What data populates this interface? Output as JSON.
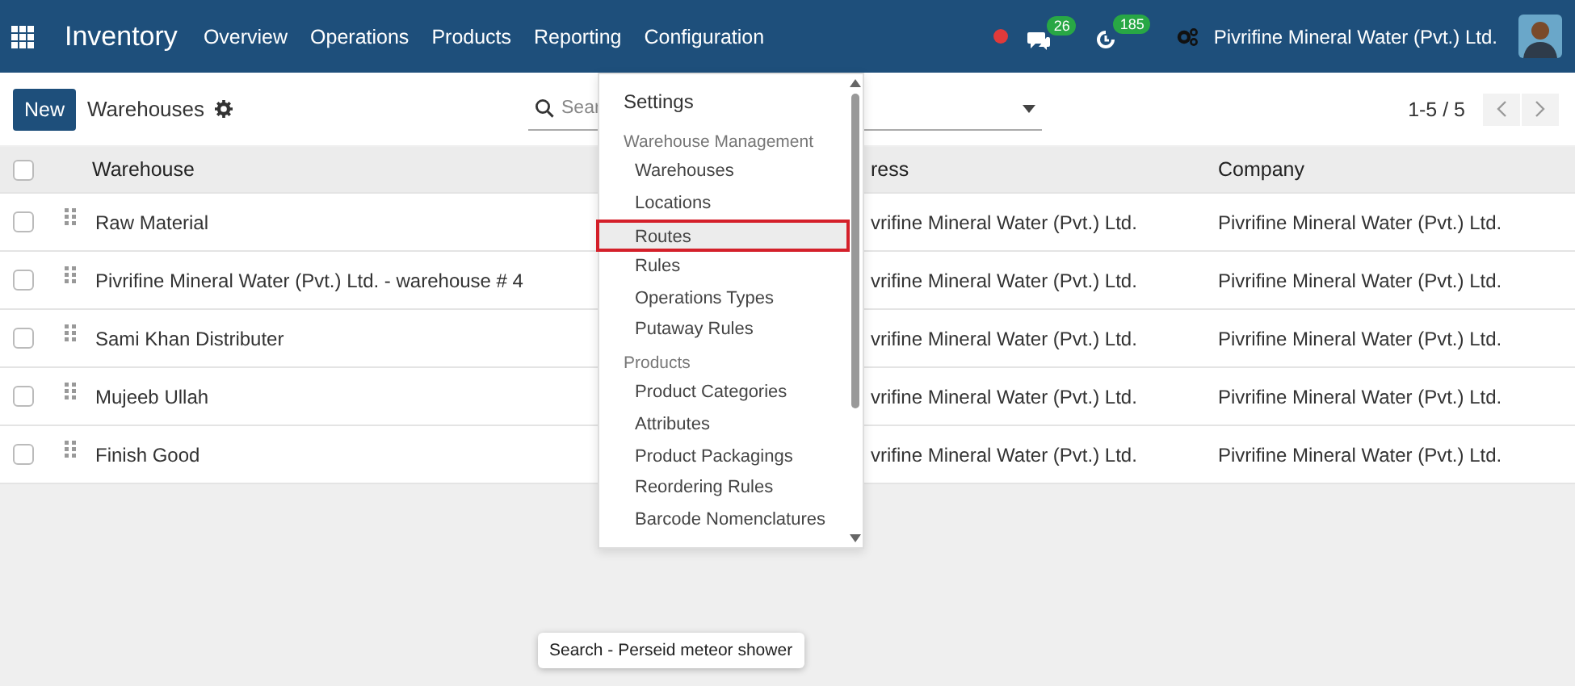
{
  "navbar": {
    "app_name": "Inventory",
    "menu": [
      {
        "label": "Overview"
      },
      {
        "label": "Operations"
      },
      {
        "label": "Products"
      },
      {
        "label": "Reporting"
      },
      {
        "label": "Configuration"
      }
    ],
    "messages_badge": "26",
    "activities_badge": "185",
    "company": "Pivrifine Mineral Water (Pvt.) Ltd."
  },
  "control_panel": {
    "new_button": "New",
    "breadcrumb": "Warehouses",
    "search": {
      "value": "Sear"
    },
    "pager": "1-5 / 5"
  },
  "table": {
    "select_all": {
      "checked": false
    },
    "columns": [
      "Warehouse",
      "ress",
      "Company"
    ],
    "rows": [
      {
        "checked": false,
        "warehouse": "Raw Material",
        "address": "vrifine Mineral Water (Pvt.) Ltd.",
        "company": "Pivrifine Mineral Water (Pvt.) Ltd."
      },
      {
        "checked": false,
        "warehouse": "Pivrifine Mineral Water (Pvt.) Ltd. - warehouse # 4",
        "address": "vrifine Mineral Water (Pvt.) Ltd.",
        "company": "Pivrifine Mineral Water (Pvt.) Ltd."
      },
      {
        "checked": false,
        "warehouse": "Sami Khan Distributer",
        "address": "vrifine Mineral Water (Pvt.) Ltd.",
        "company": "Pivrifine Mineral Water (Pvt.) Ltd."
      },
      {
        "checked": false,
        "warehouse": "Mujeeb Ullah",
        "address": "vrifine Mineral Water (Pvt.) Ltd.",
        "company": "Pivrifine Mineral Water (Pvt.) Ltd."
      },
      {
        "checked": false,
        "warehouse": "Finish Good",
        "address": "vrifine Mineral Water (Pvt.) Ltd.",
        "company": "Pivrifine Mineral Water (Pvt.) Ltd."
      }
    ]
  },
  "dropdown": {
    "items": [
      {
        "kind": "top",
        "label": "Settings"
      },
      {
        "kind": "header",
        "label": "Warehouse Management"
      },
      {
        "kind": "item",
        "label": "Warehouses",
        "highlighted": false
      },
      {
        "kind": "item",
        "label": "Locations",
        "highlighted": false
      },
      {
        "kind": "item",
        "label": "Routes",
        "highlighted": true
      },
      {
        "kind": "item",
        "label": "Rules",
        "highlighted": false
      },
      {
        "kind": "item",
        "label": "Operations Types",
        "highlighted": false
      },
      {
        "kind": "item",
        "label": "Putaway Rules",
        "highlighted": false
      },
      {
        "kind": "header",
        "label": "Products"
      },
      {
        "kind": "item",
        "label": "Product Categories",
        "highlighted": false
      },
      {
        "kind": "item",
        "label": "Attributes",
        "highlighted": false
      },
      {
        "kind": "item",
        "label": "Product Packagings",
        "highlighted": false
      },
      {
        "kind": "item",
        "label": "Reordering Rules",
        "highlighted": false
      },
      {
        "kind": "item",
        "label": "Barcode Nomenclatures",
        "highlighted": false
      }
    ]
  },
  "tooltip": "Search - Perseid meteor shower"
}
